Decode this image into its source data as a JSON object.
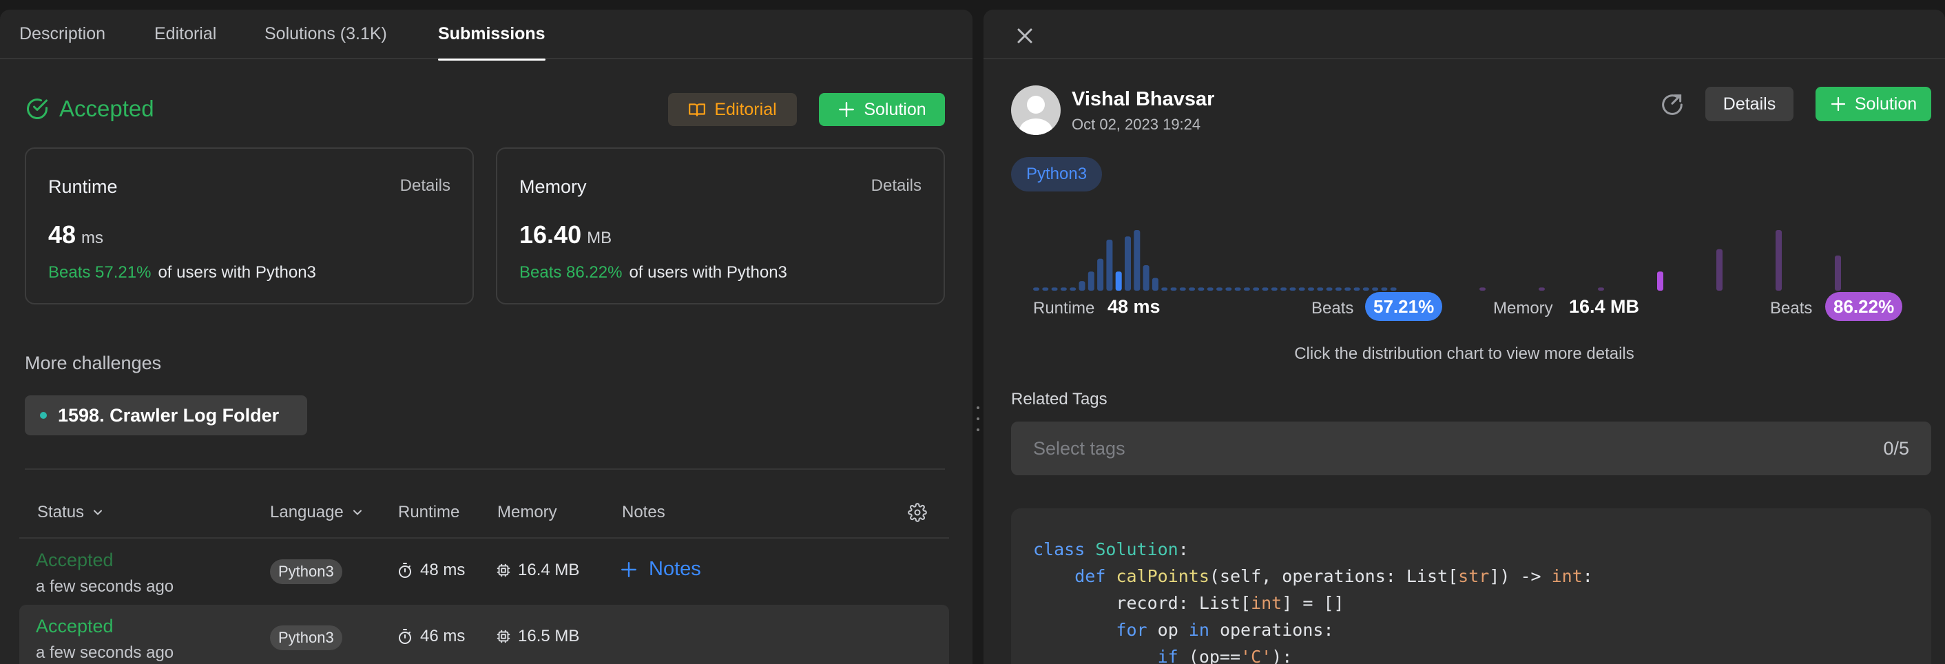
{
  "tabs": [
    {
      "label": "Description"
    },
    {
      "label": "Editorial"
    },
    {
      "label": "Solutions (3.1K)"
    },
    {
      "label": "Submissions"
    }
  ],
  "result": {
    "status": "Accepted",
    "editorial_btn": "Editorial",
    "solution_btn": "Solution"
  },
  "runtime_card": {
    "label": "Runtime",
    "details": "Details",
    "value": "48",
    "unit": "ms",
    "beats": "Beats 57.21%",
    "beats_suffix": "of users with Python3"
  },
  "memory_card": {
    "label": "Memory",
    "details": "Details",
    "value": "16.40",
    "unit": "MB",
    "beats": "Beats 86.22%",
    "beats_suffix": "of users with Python3"
  },
  "more_challenges": {
    "title": "More challenges",
    "item": "1598. Crawler Log Folder"
  },
  "table": {
    "headers": {
      "status": "Status",
      "language": "Language",
      "runtime": "Runtime",
      "memory": "Memory",
      "notes": "Notes"
    },
    "rows": [
      {
        "status": "Accepted",
        "when": "a few seconds ago",
        "language": "Python3",
        "runtime": "48 ms",
        "memory": "16.4 MB",
        "notes": "Notes"
      },
      {
        "status": "Accepted",
        "when": "a few seconds ago",
        "language": "Python3",
        "runtime": "46 ms",
        "memory": "16.5 MB"
      }
    ]
  },
  "detail": {
    "author": "Vishal Bhavsar",
    "date": "Oct 02, 2023 19:24",
    "details_btn": "Details",
    "solution_btn": "Solution",
    "language": "Python3",
    "runtime_label": "Runtime",
    "runtime_value": "48 ms",
    "runtime_beats_label": "Beats",
    "runtime_beats": "57.21%",
    "memory_label": "Memory",
    "memory_value": "16.4 MB",
    "memory_beats_label": "Beats",
    "memory_beats": "86.22%",
    "hint": "Click the distribution chart to view more details",
    "tags_title": "Related Tags",
    "tags_placeholder": "Select tags",
    "tags_count": "0/5"
  },
  "chart_data": [
    {
      "type": "bar",
      "series": [
        {
          "values": [
            1,
            1,
            1,
            1,
            1,
            3,
            6,
            10,
            16,
            6,
            17,
            19,
            8,
            4,
            1,
            1,
            1,
            1,
            1,
            1,
            1,
            1,
            1,
            1,
            1,
            1,
            1,
            1,
            1,
            1,
            1,
            1,
            1,
            1,
            1,
            1,
            1,
            1,
            1,
            1
          ]
        }
      ],
      "highlight_index": 9,
      "colors": {
        "bar": "#2f4f86",
        "highlight": "#3b82f6"
      }
    },
    {
      "type": "bar",
      "series": [
        {
          "values": [
            1,
            1,
            1,
            6,
            13,
            19,
            11
          ]
        }
      ],
      "highlight_index": 3,
      "colors": {
        "bar": "#57396f",
        "highlight": "#b04fe0"
      }
    }
  ],
  "code": {
    "lines": [
      [
        [
          "kw",
          "class "
        ],
        [
          "cls",
          "Solution"
        ],
        [
          "pl",
          ":"
        ]
      ],
      [
        [
          "pl",
          "    "
        ],
        [
          "kw",
          "def "
        ],
        [
          "fn",
          "calPoints"
        ],
        [
          "pl",
          "(self, operations: List["
        ],
        [
          "ty",
          "str"
        ],
        [
          "pl",
          "]) -> "
        ],
        [
          "ty",
          "int"
        ],
        [
          "pl",
          ":"
        ]
      ],
      [
        [
          "pl",
          "        record: List["
        ],
        [
          "ty",
          "int"
        ],
        [
          "pl",
          "] = []"
        ]
      ],
      [
        [
          "pl",
          "        "
        ],
        [
          "kw",
          "for "
        ],
        [
          "pl",
          "op "
        ],
        [
          "kw",
          "in "
        ],
        [
          "pl",
          "operations:"
        ]
      ],
      [
        [
          "pl",
          "            "
        ],
        [
          "kw",
          "if "
        ],
        [
          "pl",
          "(op=="
        ],
        [
          "st",
          "'C'"
        ],
        [
          "pl",
          "):"
        ]
      ]
    ]
  }
}
